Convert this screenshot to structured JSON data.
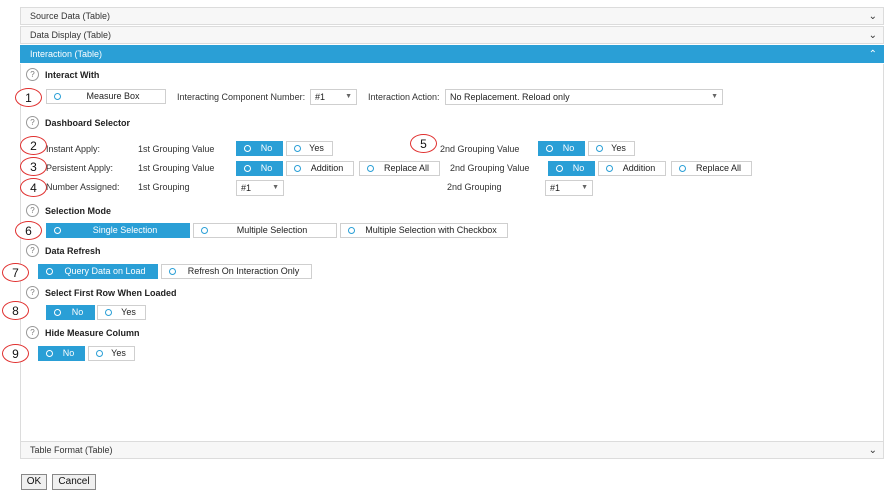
{
  "panels": {
    "source_data": "Source Data (Table)",
    "data_display": "Data Display (Table)",
    "interaction": "Interaction (Table)",
    "table_format": "Table Format (Table)"
  },
  "help_icon": "?",
  "interact_with": {
    "title": "Interact With",
    "option": "Measure Box",
    "component_label": "Interacting Component Number:",
    "component_value": "#1",
    "action_label": "Interaction Action:",
    "action_value": "No Replacement. Reload only"
  },
  "dashboard_selector": {
    "title": "Dashboard Selector",
    "instant_apply": {
      "label": "Instant Apply:",
      "g1_label": "1st Grouping Value",
      "g1_no": "No",
      "g1_yes": "Yes",
      "g2_label": "2nd Grouping Value",
      "g2_no": "No",
      "g2_yes": "Yes"
    },
    "persistent_apply": {
      "label": "Persistent Apply:",
      "g1_label": "1st Grouping Value",
      "g1_no": "No",
      "g1_addition": "Addition",
      "g1_replace": "Replace All",
      "g2_label": "2nd Grouping Value",
      "g2_no": "No",
      "g2_addition": "Addition",
      "g2_replace": "Replace All"
    },
    "number_assigned": {
      "label": "Number Assigned:",
      "g1_label": "1st Grouping",
      "g1_value": "#1",
      "g2_label": "2nd Grouping",
      "g2_value": "#1"
    }
  },
  "selection_mode": {
    "title": "Selection Mode",
    "single": "Single Selection",
    "multiple": "Multiple Selection",
    "multiple_checkbox": "Multiple Selection with Checkbox"
  },
  "data_refresh": {
    "title": "Data Refresh",
    "query_on_load": "Query Data on Load",
    "refresh_on_interaction": "Refresh On Interaction Only"
  },
  "select_first_row": {
    "title": "Select First Row When Loaded",
    "no": "No",
    "yes": "Yes"
  },
  "hide_measure": {
    "title": "Hide Measure Column",
    "no": "No",
    "yes": "Yes"
  },
  "callouts": [
    "1",
    "2",
    "3",
    "4",
    "5",
    "6",
    "7",
    "8",
    "9"
  ],
  "buttons": {
    "ok": "OK",
    "cancel": "Cancel"
  },
  "icons": {
    "chevron_down": "chevron-down-icon",
    "chevron_up": "chevron-up-icon",
    "arrow": "caret-down-icon"
  },
  "colors": {
    "accent": "#2a9fd6",
    "callout_border": "#e0302f"
  }
}
